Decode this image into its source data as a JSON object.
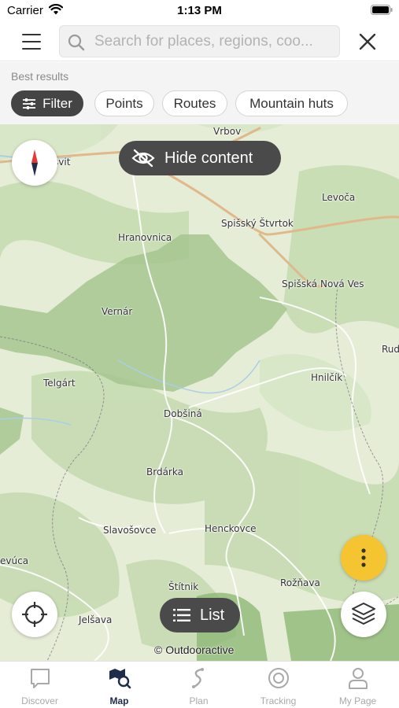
{
  "status_bar": {
    "carrier": "Carrier",
    "time": "1:13 PM"
  },
  "header": {
    "search_placeholder": "Search for places, regions, coo..."
  },
  "results": {
    "label": "Best results",
    "chips": [
      "Filter",
      "Points",
      "Routes",
      "Mountain huts"
    ]
  },
  "map": {
    "hide_content_label": "Hide content",
    "list_label": "List",
    "attribution": "© Outdooractive",
    "places": [
      "Vrbov",
      "Levoča",
      "Spišský Štvrtok",
      "Hranovnica",
      "Spišská Nová Ves",
      "Vernár",
      "Rud",
      "Telgárt",
      "Hnilčík",
      "Dobšiná",
      "Brdárka",
      "Slavošovce",
      "Henckovce",
      "evúca",
      "Štítnik",
      "Rožňava",
      "Jelšava",
      "svit"
    ]
  },
  "tabbar": {
    "tabs": [
      "Discover",
      "Map",
      "Plan",
      "Tracking",
      "My Page"
    ],
    "active": "Map"
  },
  "colors": {
    "accent_yellow": "#f5c431",
    "dark_pill": "#4a4a4a",
    "active_tab": "#1f2c4a",
    "forest": "#8fb877",
    "park": "#a5c58f"
  }
}
